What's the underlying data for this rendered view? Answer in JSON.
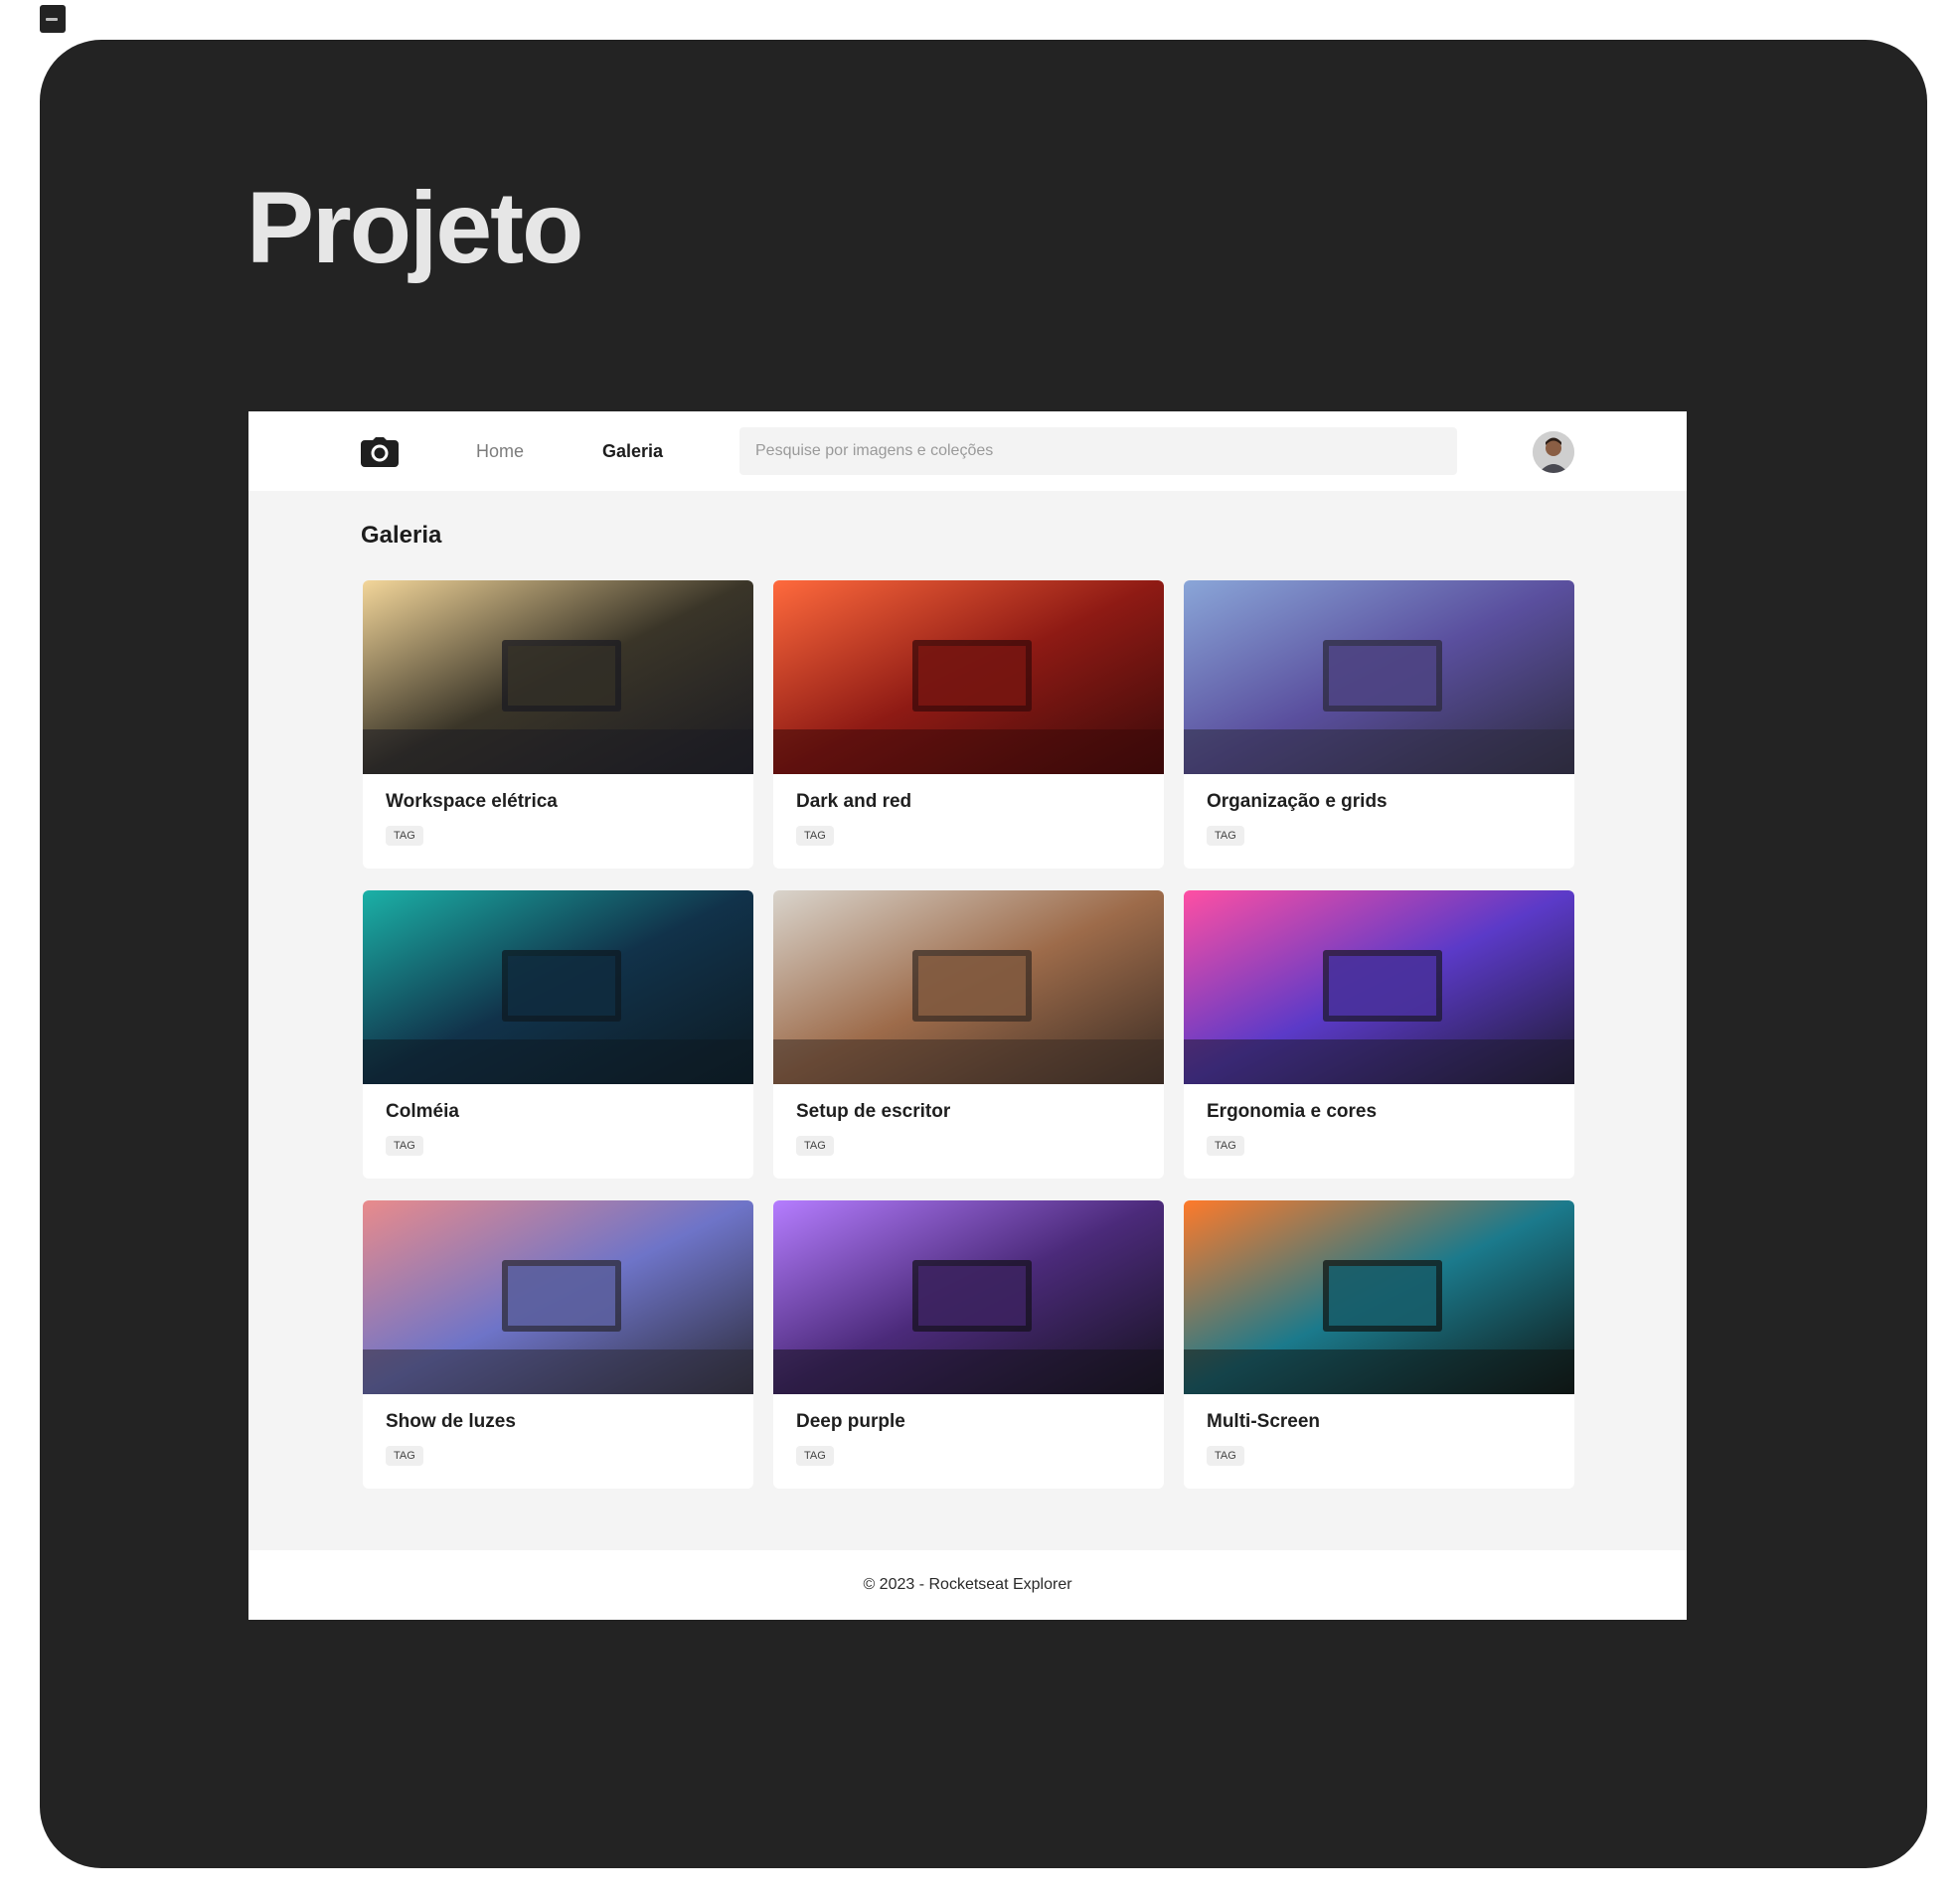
{
  "page": {
    "title": "Projeto"
  },
  "nav": {
    "logo_icon": "camera-icon",
    "home_label": "Home",
    "galeria_label": "Galeria",
    "search_placeholder": "Pesquise por imagens e coleções",
    "avatar": "user-avatar"
  },
  "gallery": {
    "heading": "Galeria",
    "cards": [
      {
        "title": "Workspace elétrica",
        "tag": "TAG",
        "colors": [
          "#f3d69a",
          "#3a3528",
          "#1b1b22"
        ]
      },
      {
        "title": "Dark and red",
        "tag": "TAG",
        "colors": [
          "#ff6a3d",
          "#8e1a14",
          "#3a0a0a"
        ]
      },
      {
        "title": "Organização e grids",
        "tag": "TAG",
        "colors": [
          "#8aa6d8",
          "#5a4f9e",
          "#2c2a3c"
        ]
      },
      {
        "title": "Colméia",
        "tag": "TAG",
        "colors": [
          "#1bb1a7",
          "#11324a",
          "#0d1a22"
        ]
      },
      {
        "title": "Setup de escritor",
        "tag": "TAG",
        "colors": [
          "#d9d4cc",
          "#9d6b4a",
          "#3a2c24"
        ]
      },
      {
        "title": "Ergonomia e cores",
        "tag": "TAG",
        "colors": [
          "#ff4fa3",
          "#5b3ac8",
          "#1e1a2e"
        ]
      },
      {
        "title": "Show de luzes",
        "tag": "TAG",
        "colors": [
          "#e98b8b",
          "#6e74c8",
          "#2b2a36"
        ]
      },
      {
        "title": "Deep purple",
        "tag": "TAG",
        "colors": [
          "#b57dff",
          "#4b2a7a",
          "#15121d"
        ]
      },
      {
        "title": "Multi-Screen",
        "tag": "TAG",
        "colors": [
          "#ff7a2a",
          "#1b7a8c",
          "#0f1614"
        ]
      }
    ]
  },
  "footer": {
    "text": "© 2023 - Rocketseat Explorer"
  }
}
